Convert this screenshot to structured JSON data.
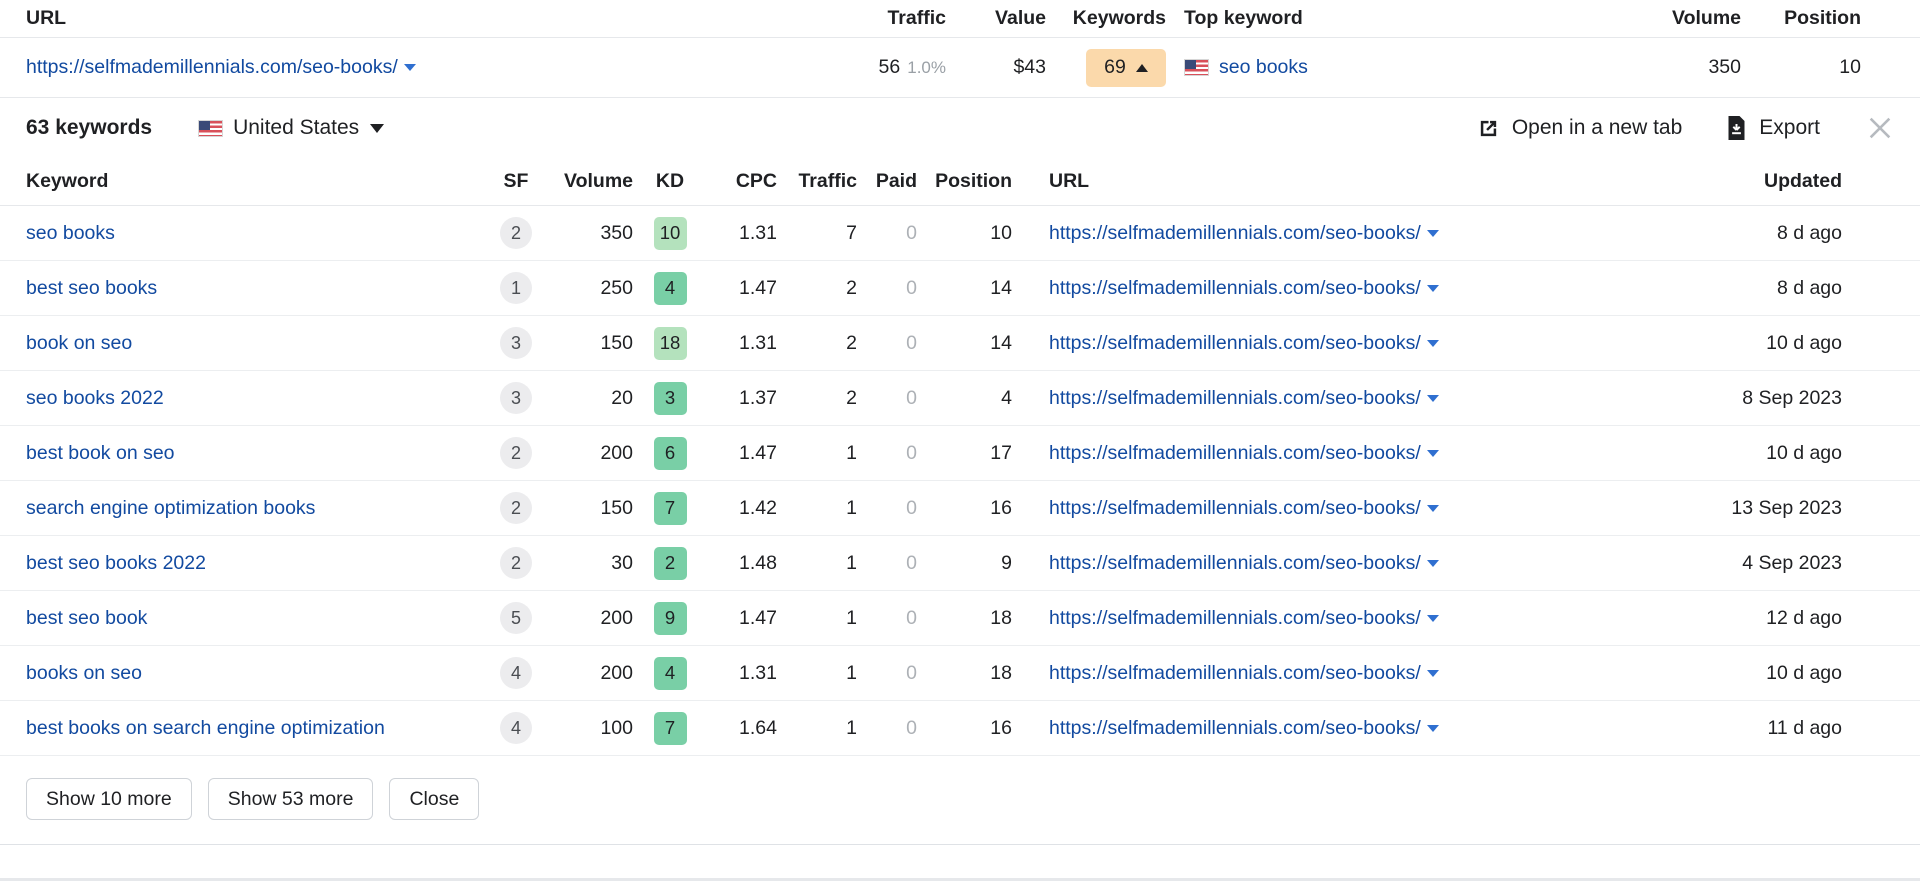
{
  "outer_table": {
    "columns": [
      "URL",
      "Traffic",
      "Value",
      "Keywords",
      "Top keyword",
      "Volume",
      "Position"
    ],
    "row": {
      "url": "https://selfmademillennials.com/seo-books/",
      "traffic": "56",
      "traffic_pct": "1.0%",
      "value": "$43",
      "keywords": "69",
      "keywords_trend": "up",
      "top_keyword": "seo books",
      "top_keyword_country": "United States",
      "volume": "350",
      "position": "10"
    }
  },
  "panel": {
    "title": "63 keywords",
    "country": "United States",
    "open_new_tab_label": "Open in a new tab",
    "export_label": "Export",
    "close_label": "Close panel",
    "icons": {
      "open_new_tab": "external-link-icon",
      "export": "download-file-icon",
      "close": "close-icon",
      "flag": "us-flag-icon"
    }
  },
  "keywords_table": {
    "columns": [
      "Keyword",
      "SF",
      "Volume",
      "KD",
      "CPC",
      "Traffic",
      "Paid",
      "Position",
      "URL",
      "Updated"
    ],
    "rows": [
      {
        "keyword": "seo books",
        "sf": "2",
        "volume": "350",
        "kd": "10",
        "kd_color": "#b4e2bd",
        "cpc": "1.31",
        "traffic": "7",
        "paid": "0",
        "position": "10",
        "url": "https://selfmademillennials.com/seo-books/",
        "updated": "8 d ago"
      },
      {
        "keyword": "best seo books",
        "sf": "1",
        "volume": "250",
        "kd": "4",
        "kd_color": "#73ceا9",
        "cpc": "1.47",
        "traffic": "2",
        "paid": "0",
        "position": "14",
        "url": "https://selfmademillennials.com/seo-books/",
        "updated": "8 d ago"
      },
      {
        "keyword": "book on seo",
        "sf": "3",
        "volume": "150",
        "kd": "18",
        "kd_color": "#b4e2bd",
        "cpc": "1.31",
        "traffic": "2",
        "paid": "0",
        "position": "14",
        "url": "https://selfmademillennials.com/seo-books/",
        "updated": "10 d ago"
      },
      {
        "keyword": "seo books 2022",
        "sf": "3",
        "volume": "20",
        "kd": "3",
        "kd_color": "#79cfa6",
        "cpc": "1.37",
        "traffic": "2",
        "paid": "0",
        "position": "4",
        "url": "https://selfmademillennials.com/seo-books/",
        "updated": "8 Sep 2023"
      },
      {
        "keyword": "best book on seo",
        "sf": "2",
        "volume": "200",
        "kd": "6",
        "kd_color": "#79cfa6",
        "cpc": "1.47",
        "traffic": "1",
        "paid": "0",
        "position": "17",
        "url": "https://selfmademillennials.com/seo-books/",
        "updated": "10 d ago"
      },
      {
        "keyword": "search engine optimization books",
        "sf": "2",
        "volume": "150",
        "kd": "7",
        "kd_color": "#79cfa6",
        "cpc": "1.42",
        "traffic": "1",
        "paid": "0",
        "position": "16",
        "url": "https://selfmademillennials.com/seo-books/",
        "updated": "13 Sep 2023"
      },
      {
        "keyword": "best seo books 2022",
        "sf": "2",
        "volume": "30",
        "kd": "2",
        "kd_color": "#79cfa6",
        "cpc": "1.48",
        "traffic": "1",
        "paid": "0",
        "position": "9",
        "url": "https://selfmademillennials.com/seo-books/",
        "updated": "4 Sep 2023"
      },
      {
        "keyword": "best seo book",
        "sf": "5",
        "volume": "200",
        "kd": "9",
        "kd_color": "#79cfa6",
        "cpc": "1.47",
        "traffic": "1",
        "paid": "0",
        "position": "18",
        "url": "https://selfmademillennials.com/seo-books/",
        "updated": "12 d ago"
      },
      {
        "keyword": "books on seo",
        "sf": "4",
        "volume": "200",
        "kd": "4",
        "kd_color": "#79cfa6",
        "cpc": "1.31",
        "traffic": "1",
        "paid": "0",
        "position": "18",
        "url": "https://selfmademillennials.com/seo-books/",
        "updated": "10 d ago"
      },
      {
        "keyword": "best books on search engine optimization",
        "sf": "4",
        "volume": "100",
        "kd": "7",
        "kd_color": "#79cfa6",
        "cpc": "1.64",
        "traffic": "1",
        "paid": "0",
        "position": "16",
        "url": "https://selfmademillennials.com/seo-books/",
        "updated": "11 d ago"
      }
    ]
  },
  "footer": {
    "show_10_more": "Show 10 more",
    "show_53_more": "Show 53 more",
    "close": "Close"
  },
  "colors": {
    "link": "#124aa0",
    "keywords_badge_bg": "#fbd9ab",
    "kd_low": "#79cfa6",
    "kd_mid": "#b4e2bd",
    "muted": "#9aa0a6"
  }
}
